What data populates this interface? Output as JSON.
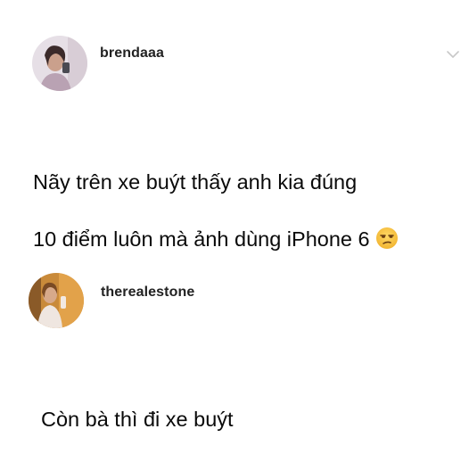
{
  "posts": [
    {
      "username": "brendaaa",
      "text_line1": "Nãy trên xe buýt thấy anh kia đúng",
      "text_line2": "10 điểm luôn mà ảnh dùng iPhone 6",
      "emoji_icon": "unamused-face-icon"
    },
    {
      "username": "therealestone",
      "text_line1": "Còn bà thì đi xe buýt"
    }
  ],
  "icons": {
    "expand": "chevron-down-icon"
  },
  "colors": {
    "background": "#ffffff",
    "text": "#0a0a0a",
    "chevron": "#c8c8c8",
    "emoji": "#f7c948"
  }
}
